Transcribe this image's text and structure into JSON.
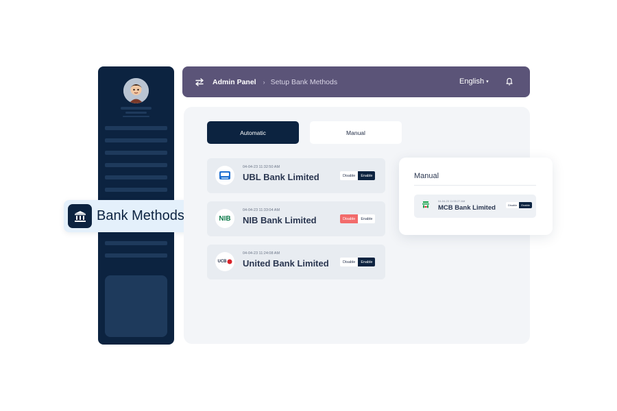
{
  "header": {
    "breadcrumb_root": "Admin Panel",
    "breadcrumb_sep": "›",
    "breadcrumb_current": "Setup Bank Methods",
    "language": "English",
    "language_caret": "▾"
  },
  "badge": {
    "label": "Bank Methods",
    "icon": "bank-icon"
  },
  "tabs": {
    "automatic": "Automatic",
    "manual": "Manual"
  },
  "banks": [
    {
      "date": "04-04-23 11:32:50 AM",
      "name": "UBL Bank Limited",
      "disable": "Disable",
      "enable": "Enable",
      "active": "enable"
    },
    {
      "date": "04-04-23 11:33:04 AM",
      "name": "NIB Bank Limited",
      "disable": "Disable",
      "enable": "Enable",
      "active": "disable",
      "logo_text": "NIB"
    },
    {
      "date": "04-04-23 11:24:08 AM",
      "name": "United Bank Limited",
      "disable": "Disable",
      "enable": "Enable",
      "active": "enable",
      "logo_text": "UCB"
    }
  ],
  "manual_panel": {
    "title": "Manual",
    "bank": {
      "date": "04-04-23 11:55:27 AM",
      "name": "MCB Bank Limited",
      "disable": "Disable",
      "enable": "Enable",
      "active": "enable"
    }
  },
  "colors": {
    "sidebar": "#0c2340",
    "header": "#5b5478",
    "active": "#0c2340",
    "danger": "#f26b6b",
    "panel": "#f3f5f8"
  }
}
